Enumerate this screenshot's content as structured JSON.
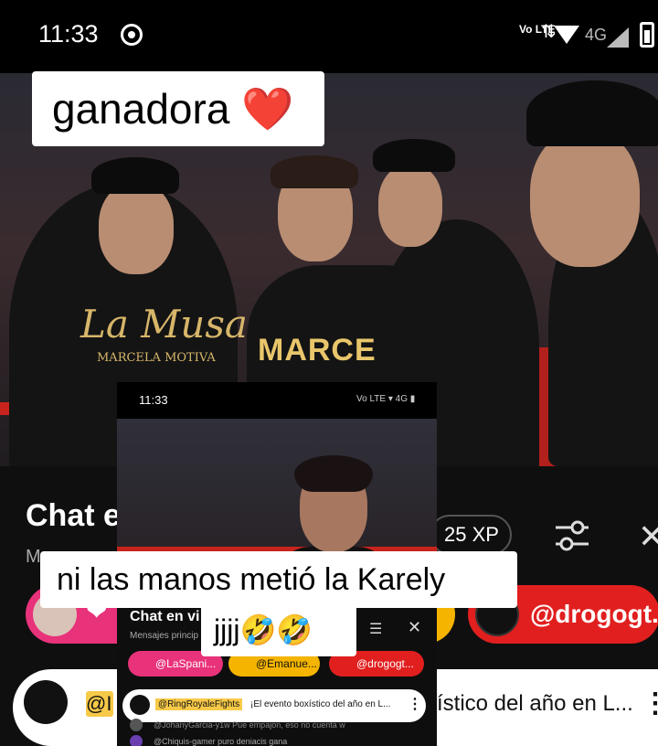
{
  "status_bar": {
    "time": "11:33",
    "volte": "Vo LTE",
    "network": "4G"
  },
  "captions": {
    "top": "ganadora",
    "top_emoji": "❤️",
    "middle": "ni las manos metió la Karely",
    "laugh": "jjjj🤣🤣"
  },
  "video": {
    "shirt_brand": "La Musa",
    "shirt_name": "MARCELA MOTIVA",
    "tank_name": "MARCELA"
  },
  "chat": {
    "title": "Chat e",
    "subtitle": "M",
    "xp": "25 XP",
    "pill_pink_icon": "❤",
    "pill_red_handle": "@drogogt...",
    "pinned_handle": "@I",
    "pinned_text": "ístico del año en L..."
  },
  "mini": {
    "time": "11:33",
    "status_icons": "Vo LTE ▾ 4G ▮",
    "chat_title": "Chat en vi",
    "chat_sub": "Mensajes princip",
    "pill_pink": "@LaSpani...",
    "pill_yellow": "@Emanue...",
    "pill_red": "@drogogt...",
    "pinned_handle": "@RingRoyaleFights",
    "pinned_text": "¡El evento boxístico del año en L...",
    "msg1": "@JohanyGarcia-y1w   Pue empajon, eso no cuenta w",
    "msg2": "@Chiquis-gamer   puro deniacis gana"
  },
  "colors": {
    "pink": "#e8327a",
    "yellow": "#f5b400",
    "red": "#e11f1f",
    "rope": "#c8231d"
  }
}
